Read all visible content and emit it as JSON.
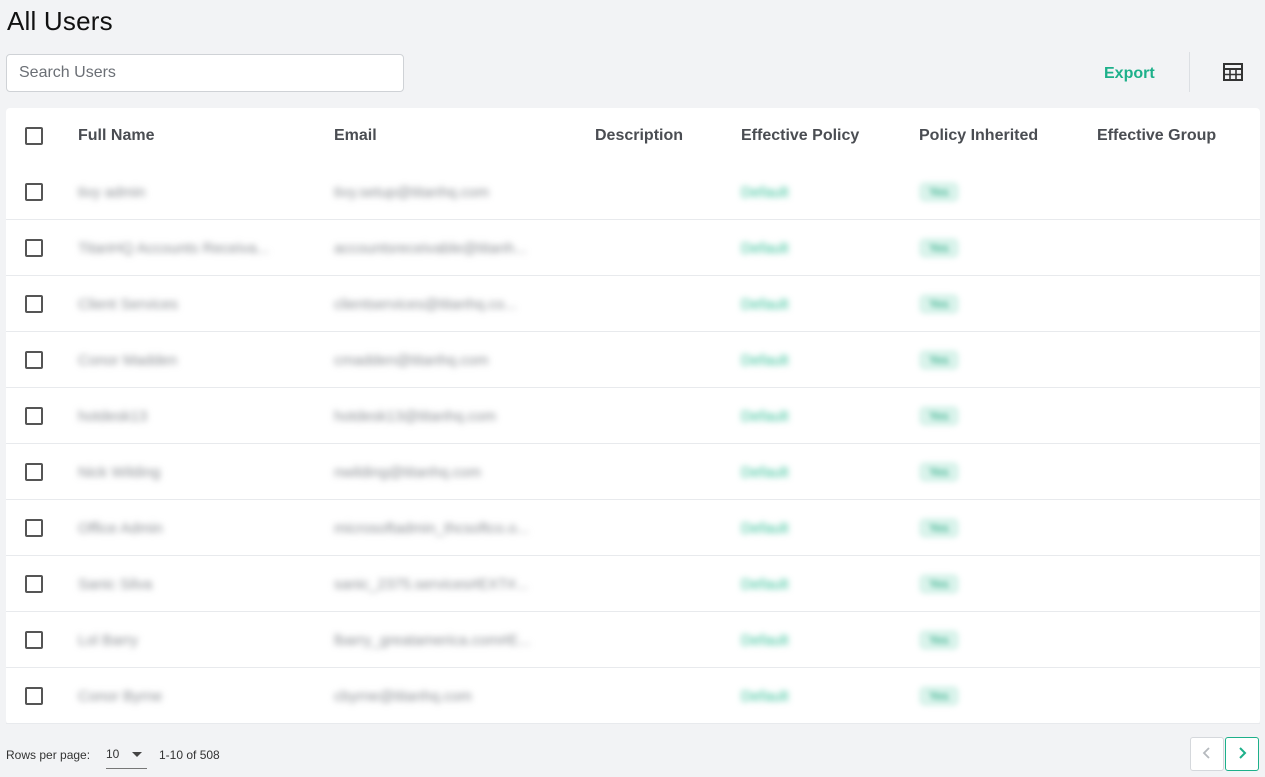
{
  "page": {
    "title": "All Users"
  },
  "search": {
    "placeholder": "Search Users",
    "value": ""
  },
  "toolbar": {
    "export_label": "Export",
    "columns_icon": "table-columns-icon"
  },
  "colors": {
    "accent": "#1db08a",
    "badge_bg": "#d9f3eb",
    "background": "#f2f3f5"
  },
  "table": {
    "columns": {
      "name": "Full Name",
      "email": "Email",
      "description": "Description",
      "policy": "Effective Policy",
      "inherited": "Policy Inherited",
      "group": "Effective Group"
    },
    "rows": [
      {
        "name": "tivy admin",
        "email": "tivy.setup@titanhq.com",
        "description": "",
        "policy": "Default",
        "inherited": "Yes",
        "group": ""
      },
      {
        "name": "TitanHQ Accounts Receiva...",
        "email": "accountsreceivable@titanh...",
        "description": "",
        "policy": "Default",
        "inherited": "Yes",
        "group": ""
      },
      {
        "name": "Client Services",
        "email": "clientservices@titanhq.co...",
        "description": "",
        "policy": "Default",
        "inherited": "Yes",
        "group": ""
      },
      {
        "name": "Conor Madden",
        "email": "cmadden@titanhq.com",
        "description": "",
        "policy": "Default",
        "inherited": "Yes",
        "group": ""
      },
      {
        "name": "hotdesk13",
        "email": "hotdesk13@titanhq.com",
        "description": "",
        "policy": "Default",
        "inherited": "Yes",
        "group": ""
      },
      {
        "name": "Nick Wilding",
        "email": "nwilding@titanhq.com",
        "description": "",
        "policy": "Default",
        "inherited": "Yes",
        "group": ""
      },
      {
        "name": "Office Admin",
        "email": "microsoftadmin_thcsoftco.o...",
        "description": "",
        "policy": "Default",
        "inherited": "Yes",
        "group": ""
      },
      {
        "name": "Sanic Silva",
        "email": "sanic_2375.services#EXT#...",
        "description": "",
        "policy": "Default",
        "inherited": "Yes",
        "group": ""
      },
      {
        "name": "Lol Barry",
        "email": "lbarry_greatamerica.com#E...",
        "description": "",
        "policy": "Default",
        "inherited": "Yes",
        "group": ""
      },
      {
        "name": "Conor Byrne",
        "email": "cbyrne@titanhq.com",
        "description": "",
        "policy": "Default",
        "inherited": "Yes",
        "group": ""
      }
    ]
  },
  "pagination": {
    "rows_per_page_label": "Rows per page:",
    "rows_per_page": "10",
    "range": "1-10 of 508"
  }
}
